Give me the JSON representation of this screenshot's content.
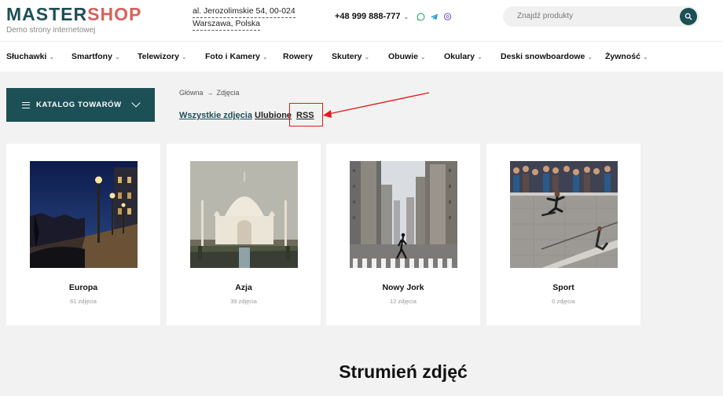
{
  "header": {
    "logo_master": "MASTER",
    "logo_shop": "SHOP",
    "tagline": "Demo strony internetowej",
    "address_line1": "al. Jerozolimskie 54, 00-024",
    "address_line2": "Warszawa, Polska",
    "phone": "+48 999 888-777",
    "search_placeholder": "Znajdź produkty"
  },
  "nav": {
    "items": [
      {
        "label": "Słuchawki",
        "dropdown": true
      },
      {
        "label": "Smartfony",
        "dropdown": true
      },
      {
        "label": "Telewizory",
        "dropdown": true
      },
      {
        "label": "Foto i Kamery",
        "dropdown": true
      },
      {
        "label": "Rowery",
        "dropdown": false
      },
      {
        "label": "Skutery",
        "dropdown": true
      },
      {
        "label": "Obuwie",
        "dropdown": true
      },
      {
        "label": "Okulary",
        "dropdown": true
      },
      {
        "label": "Deski snowboardowe",
        "dropdown": true
      },
      {
        "label": "Żywność",
        "dropdown": true
      }
    ]
  },
  "catalog": {
    "label": "KATALOG TOWARÓW"
  },
  "breadcrumb": {
    "home": "Główna",
    "current": "Zdjęcia"
  },
  "tabs": {
    "all": "Wszystkie zdjęcia",
    "favorites": "Ulubione",
    "rss": "RSS"
  },
  "albums": [
    {
      "name": "Europa",
      "count": "61 zdjęcia"
    },
    {
      "name": "Azja",
      "count": "39 zdjęcia"
    },
    {
      "name": "Nowy Jork",
      "count": "12 zdjęcia"
    },
    {
      "name": "Sport",
      "count": "0 zdjęcia"
    }
  ],
  "section_title": "Strumień zdjęć",
  "colors": {
    "brand": "#1c4f56",
    "logo_accent": "#d6625b",
    "annotation": "#e21b1b"
  },
  "icons": [
    "chevron-down-icon",
    "whatsapp-icon",
    "telegram-icon",
    "viber-icon",
    "search-icon",
    "menu-icon",
    "arrow-right-icon"
  ]
}
